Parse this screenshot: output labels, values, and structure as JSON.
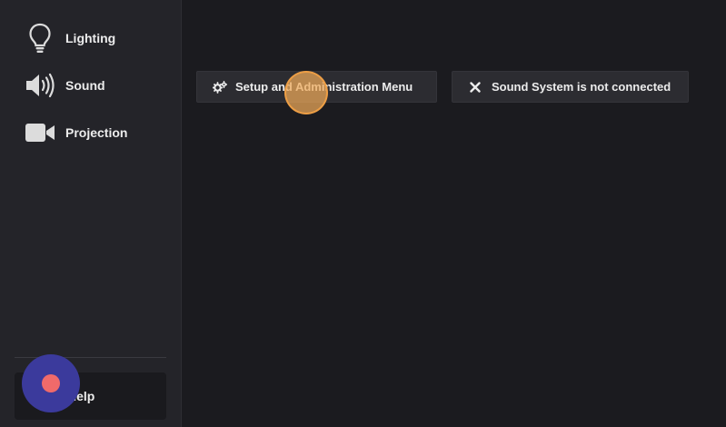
{
  "sidebar": {
    "items": [
      {
        "label": "Lighting",
        "icon": "lightbulb-icon"
      },
      {
        "label": "Sound",
        "icon": "speaker-icon"
      },
      {
        "label": "Projection",
        "icon": "video-camera-icon"
      }
    ],
    "help_label": "Help"
  },
  "toolbar": {
    "setup_label": "Setup and Administration Menu",
    "setup_icon": "cogs-icon",
    "sound_status_label": "Sound System is not connected",
    "sound_status_icon": "close-icon"
  },
  "colors": {
    "background": "#1b1b1f",
    "sidebar": "#242429",
    "button": "#2c2c31",
    "fab": "#3b3a9c",
    "fab_dot": "#f06a6a",
    "click_marker": "#f0aa5a"
  }
}
